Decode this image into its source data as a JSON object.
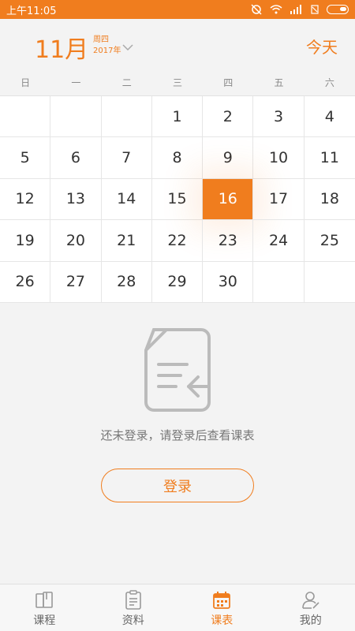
{
  "status": {
    "time": "上午11:05"
  },
  "header": {
    "month": "11月",
    "weekday": "周四",
    "year": "2017年",
    "today": "今天"
  },
  "weekdays": [
    "日",
    "一",
    "二",
    "三",
    "四",
    "五",
    "六"
  ],
  "calendar": {
    "days": [
      "",
      "",
      "",
      "1",
      "2",
      "3",
      "4",
      "5",
      "6",
      "7",
      "8",
      "9",
      "10",
      "11",
      "12",
      "13",
      "14",
      "15",
      "16",
      "17",
      "18",
      "19",
      "20",
      "21",
      "22",
      "23",
      "24",
      "25",
      "26",
      "27",
      "28",
      "29",
      "30",
      "",
      ""
    ],
    "selected": "16"
  },
  "empty_state": {
    "message": "还未登录，请登录后查看课表",
    "login_label": "登录"
  },
  "tabs": [
    {
      "label": "课程",
      "icon": "course-icon"
    },
    {
      "label": "资料",
      "icon": "material-icon"
    },
    {
      "label": "课表",
      "icon": "schedule-icon",
      "active": true
    },
    {
      "label": "我的",
      "icon": "profile-icon"
    }
  ],
  "colors": {
    "accent": "#f07d1e",
    "background": "#f3f3f3"
  }
}
